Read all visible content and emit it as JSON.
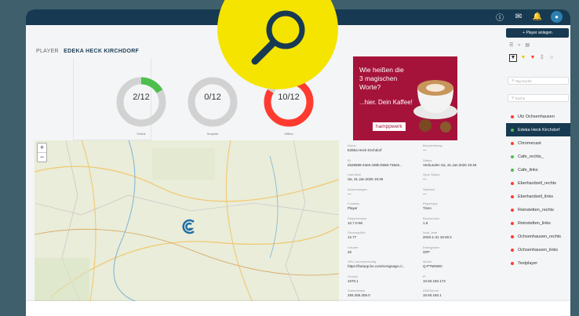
{
  "breadcrumb": {
    "section": "PLAYER",
    "current": "EDEKA HECK KIRCHDORF"
  },
  "stats": [
    {
      "value": "2/12",
      "label": "Online",
      "fraction": 0.1667,
      "color": "#4cbf4c"
    },
    {
      "value": "0/12",
      "label": "Suspekt",
      "fraction": 0.0,
      "color": "#d2d2d2"
    },
    {
      "value": "10/12",
      "label": "Offline",
      "fraction": 0.8333,
      "color": "#ff3b30"
    }
  ],
  "ad": {
    "line1": "Wie heißen die 3 magischen Worte?",
    "line2": "...hier. Dein Kaffee!",
    "brand": "hamppwerk"
  },
  "details": [
    {
      "k": "Name",
      "v": "Edeka Heck Kirchdorf"
    },
    {
      "k": "Beschreibung",
      "v": "—"
    },
    {
      "k": "ID",
      "v": "eb28699-23e6-436b-b558-735e5..."
    },
    {
      "k": "Status",
      "v": "Verbunden Sa, 31.Jan.2026 19:46"
    },
    {
      "k": "Last Alive",
      "v": "Sa, 31.Jan.2026 19:45"
    },
    {
      "k": "Sync Status",
      "v": "—"
    },
    {
      "k": "Anmerkungen",
      "v": "—"
    },
    {
      "k": "Standort",
      "v": "—"
    },
    {
      "k": "Funktion",
      "v": "Player"
    },
    {
      "k": "Playertype",
      "v": "Tizen"
    },
    {
      "k": "Playerversion",
      "v": "10.7.0-96"
    },
    {
      "k": "Bootversion",
      "v": "1.9"
    },
    {
      "k": "Devicegröße",
      "v": "12.77"
    },
    {
      "k": "local_time",
      "v": "2026-1-31 19:46:2"
    },
    {
      "k": "Volume",
      "v": "20"
    },
    {
      "k": "Energysave",
      "v": "OFF"
    },
    {
      "k": "URL Launcherkonfig",
      "v": "https://hampp.bo.com/ecsignage.ci..."
    },
    {
      "k": "Model",
      "v": "Q-PTMNWC"
    },
    {
      "k": "Version",
      "v": "1070.1"
    },
    {
      "k": "IP",
      "v": "10.60.160.173"
    },
    {
      "k": "Subnetmask",
      "v": "255.255.255.0"
    },
    {
      "k": "DNSServer",
      "v": "10.60.160.1"
    }
  ],
  "sidebar": {
    "add_button": "+ Player anlegen",
    "tag_placeholder": "Tag Suche",
    "search_placeholder": "Suche",
    "players": [
      {
        "name": "Utz Ochsenhausen",
        "status": "offline"
      },
      {
        "name": "Edeka Heck Kirchdorf",
        "status": "online",
        "selected": true
      },
      {
        "name": "Chromecast",
        "status": "offline"
      },
      {
        "name": "Cafe_rechts_",
        "status": "online"
      },
      {
        "name": "Cafe_links",
        "status": "online"
      },
      {
        "name": "Eberhardzell_rechts",
        "status": "offline"
      },
      {
        "name": "Eberhardzell_links",
        "status": "offline"
      },
      {
        "name": "Reinstetten_rechts",
        "status": "offline"
      },
      {
        "name": "Reinstetten_links",
        "status": "offline"
      },
      {
        "name": "Ochsenhausen_rechts",
        "status": "offline"
      },
      {
        "name": "Ochsenhausen_links",
        "status": "offline"
      },
      {
        "name": "Testplayer",
        "status": "offline"
      }
    ]
  },
  "colors": {
    "navy": "#173a52",
    "online": "#4cbf4c",
    "offline": "#ff3b30",
    "badge": "#f5e400"
  },
  "icons": [
    "help-icon",
    "mail-icon",
    "bell-icon",
    "user-icon",
    "search-icon",
    "layers-icon",
    "filter-icon",
    "list-icon"
  ]
}
